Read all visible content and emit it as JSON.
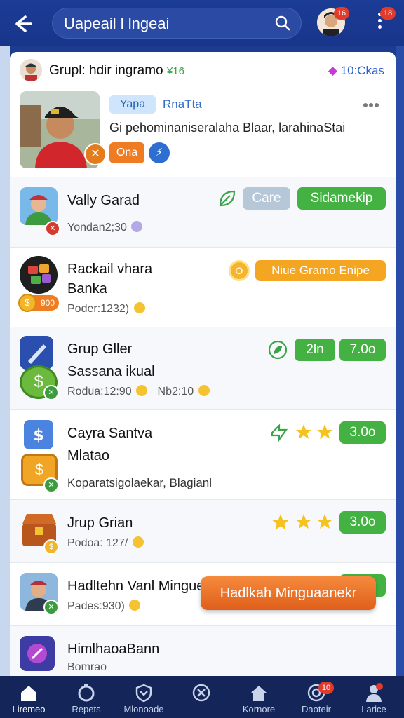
{
  "header": {
    "search_text": "Uapeail l lngeai",
    "avatar_badge": "16",
    "menu_badge": "18"
  },
  "profile": {
    "title": "Grupl: hdir ingramo",
    "title_tag": "¥16",
    "count": "10:Ckas",
    "chip": "Yapa",
    "name": "RnaTta",
    "description": "Gi pehominaniseralaha Blaar, larahinaStai",
    "button_label": "Ona"
  },
  "rows": [
    {
      "title": "Vally Garad",
      "meta": "Yondan2;30",
      "pill_grey": "Care",
      "pill_green": "Sidamekip"
    },
    {
      "title": "Rackail vhara",
      "title2": "Banka",
      "meta": "Poder:1232)",
      "coin": "900",
      "pill_orange": "Niue Gramo Enipe"
    },
    {
      "title": "Grup Gller",
      "title2": "Sassana ikual",
      "meta": "Rodua:12:90",
      "meta2": "Nb2:10",
      "pill1": "2ln",
      "pill2": "7.0o"
    },
    {
      "title": "Cayra Santva",
      "title2": "Mlatao",
      "meta": "Koparatsigolaekar, Blagianl",
      "pill": "3.0o"
    },
    {
      "title": "Jrup Grian",
      "meta": "Podoa: 127/",
      "pill": "3.0o"
    },
    {
      "title": "Hadltehn Vanl Minguevan",
      "meta": "Pades:930)",
      "pill": "3.0o"
    },
    {
      "title": "HimlhaoaBann",
      "meta": "Bomrao"
    }
  ],
  "cta": {
    "label": "Hadlkah Minguaanekr"
  },
  "bottom_nav": [
    {
      "label": "Liremeo",
      "icon": "home-icon"
    },
    {
      "label": "Repets",
      "icon": "timer-icon"
    },
    {
      "label": "Mlonoade",
      "icon": "shield-icon"
    },
    {
      "label": "",
      "icon": "crosshair-icon"
    },
    {
      "label": "Kornore",
      "icon": "house-icon"
    },
    {
      "label": "Daoteir",
      "icon": "target-icon",
      "badge": "10"
    },
    {
      "label": "Larice",
      "icon": "person-icon"
    }
  ]
}
